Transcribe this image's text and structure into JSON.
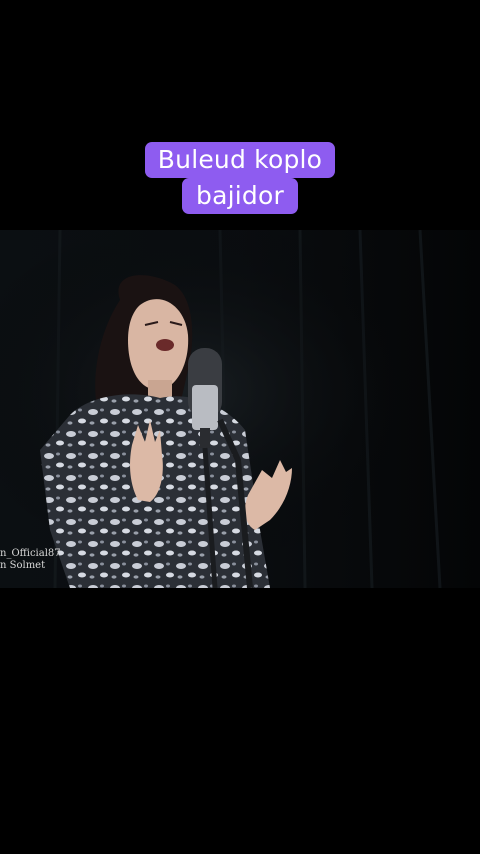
{
  "caption": {
    "line1": "Buleud koplo",
    "line2": "bajidor",
    "background": "#8e5cf0",
    "color": "#ffffff"
  },
  "video": {
    "watermark_line1": "n_Official87",
    "watermark_line2": "n Solmet"
  },
  "colors": {
    "background": "#000000",
    "curtain": "#0a0d0f"
  }
}
